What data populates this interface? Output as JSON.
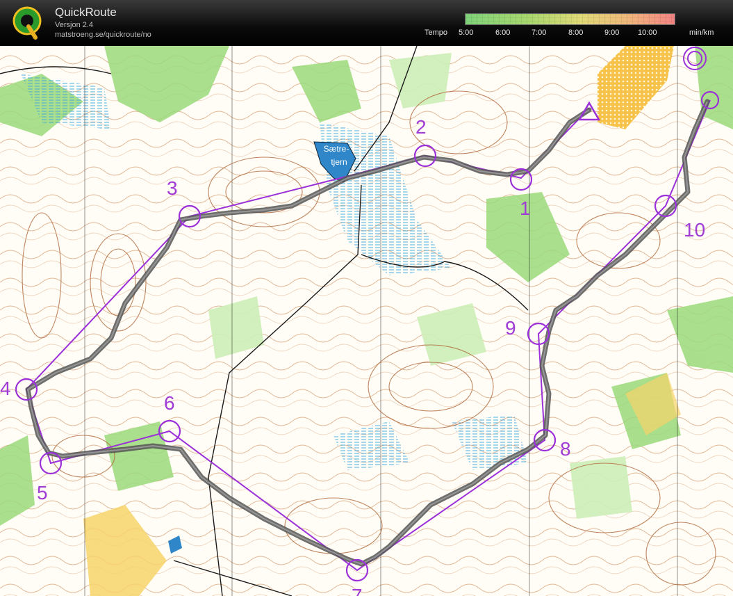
{
  "header": {
    "app_name": "QuickRoute",
    "version": "Versjon 2.4",
    "url": "matstroeng.se/quickroute/no",
    "tempo_label": "Tempo",
    "unit_label": "min/km",
    "tempo_ticks": [
      "5:00",
      "6:00",
      "7:00",
      "8:00",
      "9:00",
      "10:00"
    ]
  },
  "map": {
    "lake_name": "Sætre-\ntjern",
    "lake_line1": "Sætre-",
    "lake_line2": "tjern",
    "controls": [
      {
        "number": "1"
      },
      {
        "number": "2"
      },
      {
        "number": "3"
      },
      {
        "number": "4"
      },
      {
        "number": "5"
      },
      {
        "number": "6"
      },
      {
        "number": "7"
      },
      {
        "number": "8"
      },
      {
        "number": "9"
      },
      {
        "number": "10"
      }
    ],
    "colors": {
      "course": "#9b30d9",
      "route": "#3a3a3a",
      "forest_green": "#8fd36f",
      "open_yellow": "#f6c24a",
      "water_blue": "#3aa6de",
      "contour_brown": "#b0683a"
    }
  }
}
